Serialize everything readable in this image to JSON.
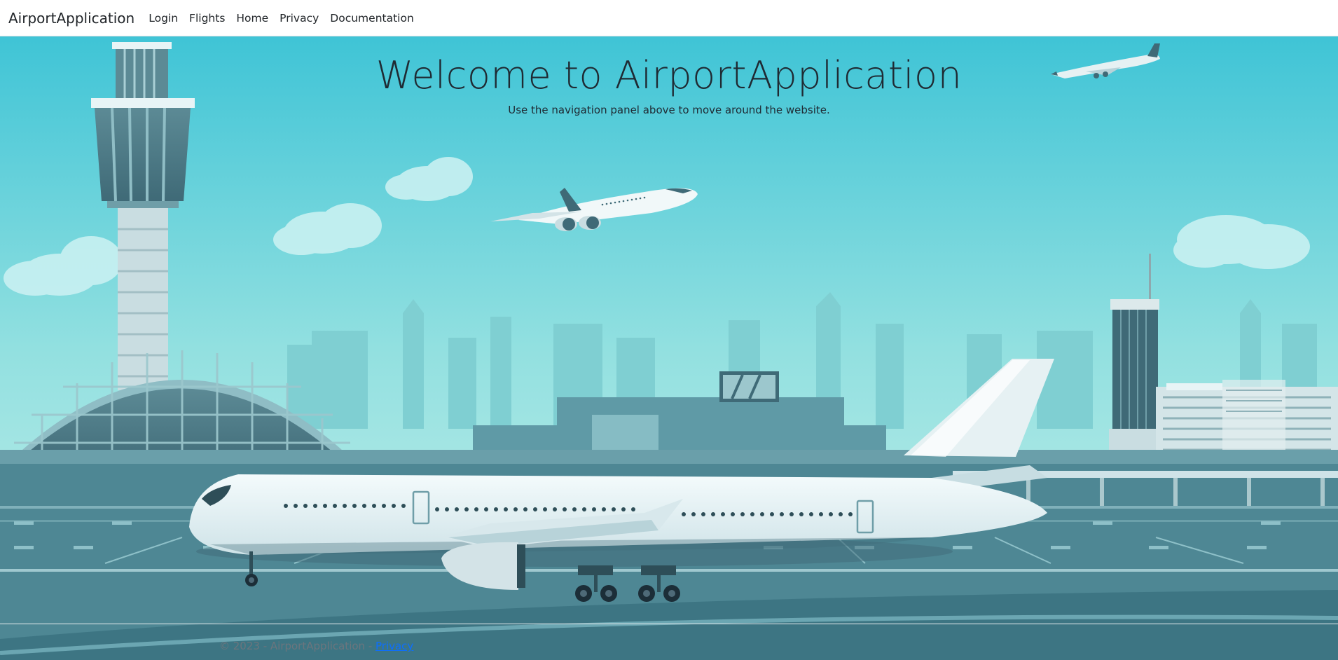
{
  "navbar": {
    "brand": "AirportApplication",
    "links": [
      "Login",
      "Flights",
      "Home",
      "Privacy",
      "Documentation"
    ]
  },
  "hero": {
    "title": "Welcome to AirportApplication",
    "subtitle": "Use the navigation panel above to move around the website."
  },
  "footer": {
    "copyright": "© 2023 - AirportApplication - ",
    "privacy_link": "Privacy"
  },
  "colors": {
    "sky_top": "#3fc4d6",
    "sky_bottom": "#c2efea",
    "ground": "#4a7f8c",
    "link": "#0d6efd"
  }
}
